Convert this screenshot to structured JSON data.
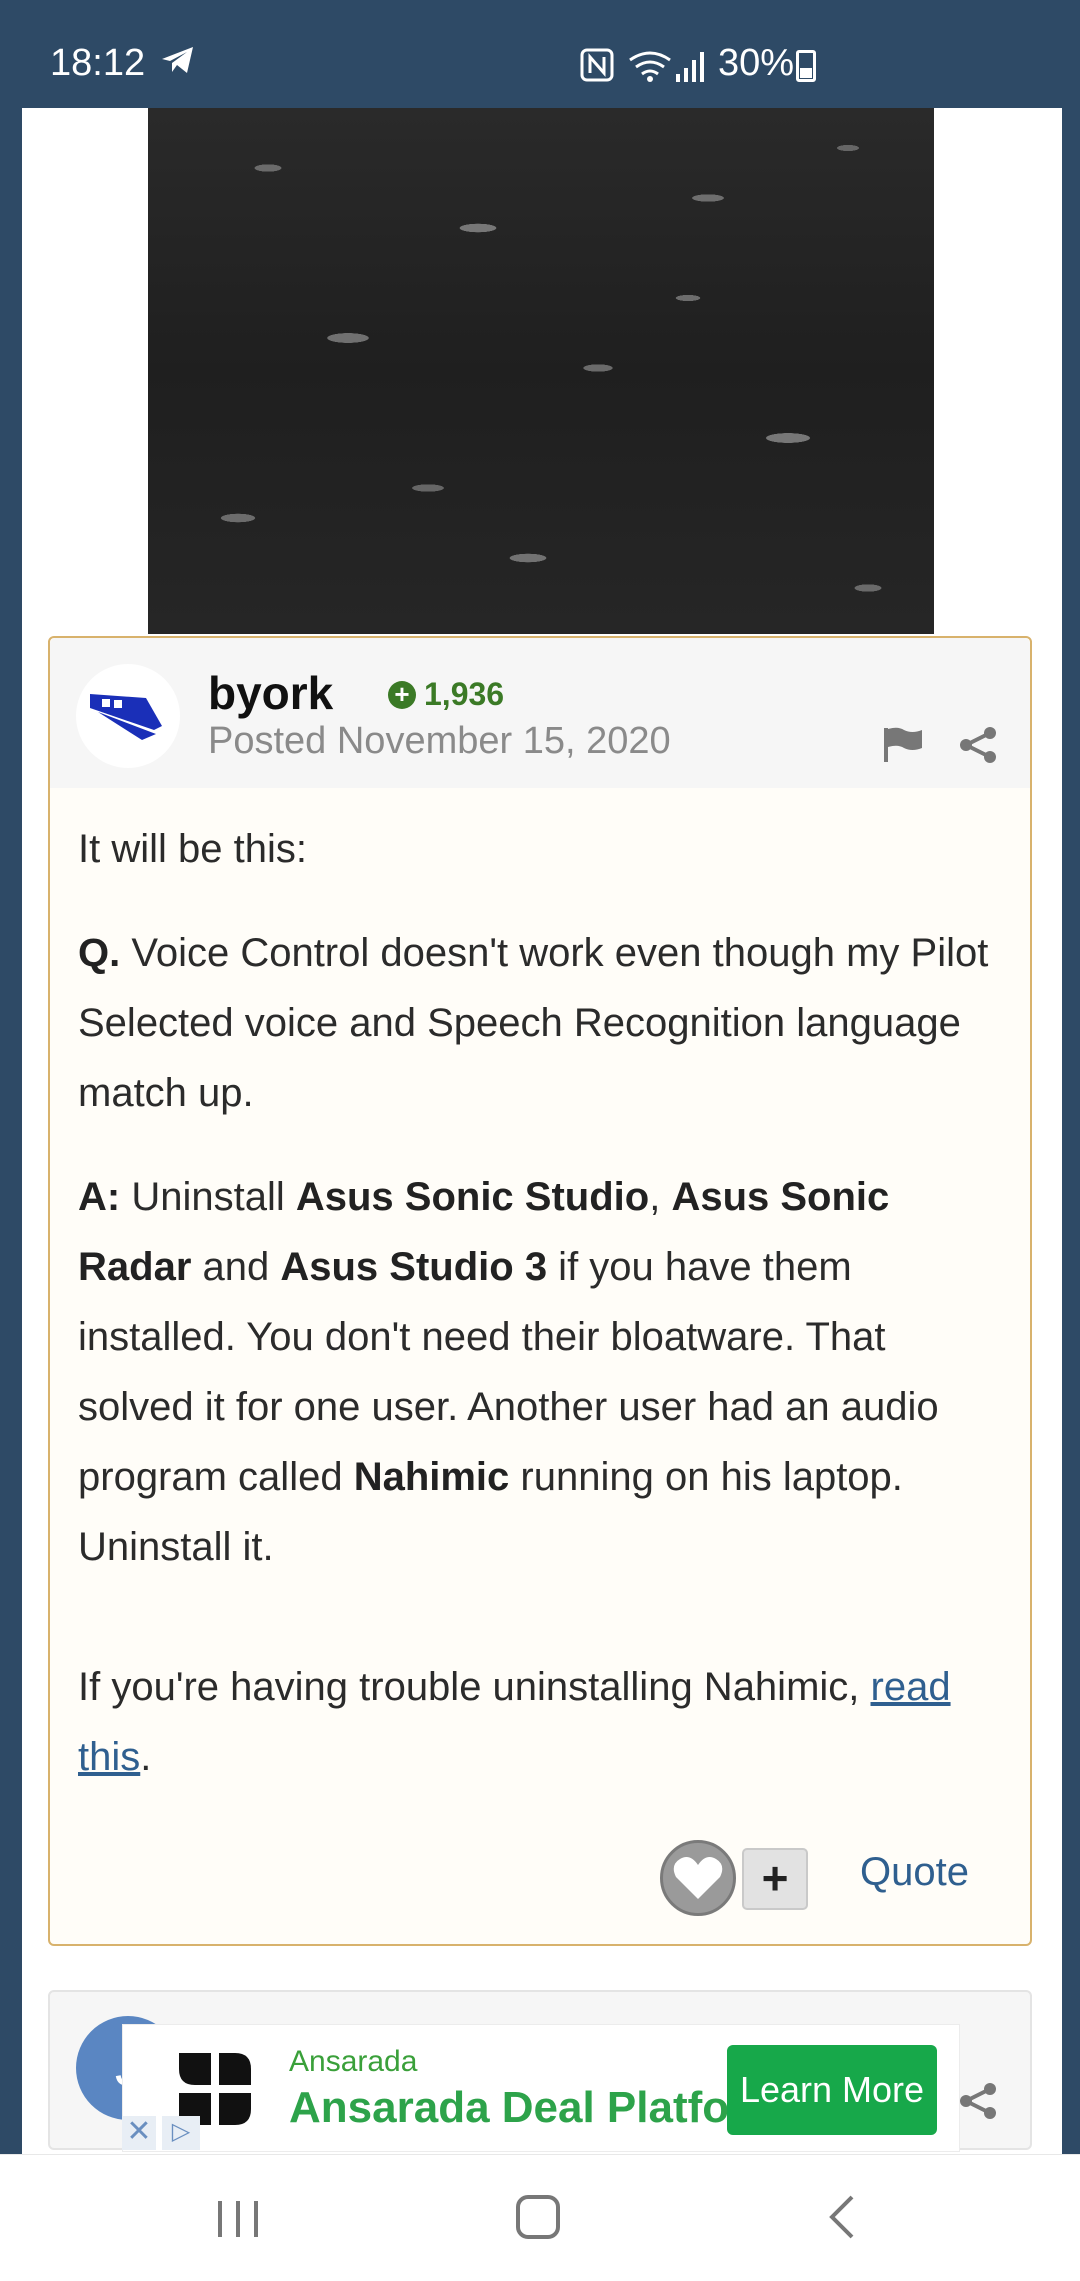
{
  "status_bar": {
    "time": "18:12",
    "battery": "30%"
  },
  "post": {
    "username": "byork",
    "reputation": "1,936",
    "posted": "Posted November 15, 2020",
    "body": {
      "intro": "It will be this:",
      "q_label": "Q.",
      "q_text": " Voice Control doesn't work even though my Pilot Selected voice and Speech Recognition language match up.",
      "a_label": "A:",
      "a_t1": " Uninstall ",
      "a_b1": "Asus Sonic Studio",
      "a_t2": ", ",
      "a_b2": "Asus Sonic Radar",
      "a_t3": " and ",
      "a_b3": "Asus Studio 3",
      "a_t4": " if you have them installed.  You don't need their bloatware. That solved it for one user.  Another user had an audio program called ",
      "a_b4": "Nahimic",
      "a_t5": " running on his laptop.  Uninstall it.",
      "trouble_text": "If you're having trouble uninstalling Nahimic, ",
      "link_text": "read this",
      "period": "."
    },
    "actions": {
      "plus": "+",
      "quote": "Quote"
    }
  },
  "next_post": {
    "avatar_letter": "J"
  },
  "ad": {
    "brand": "Ansarada",
    "title": "Ansarada Deal Platform",
    "cta": "Learn More",
    "close": "✕",
    "choices": "▷"
  },
  "colors": {
    "header_bg": "#2e4a66",
    "post_border": "#d8b26c",
    "rep_green": "#3b7a26",
    "link_blue": "#2f5f8f",
    "ad_green": "#17a84a"
  }
}
